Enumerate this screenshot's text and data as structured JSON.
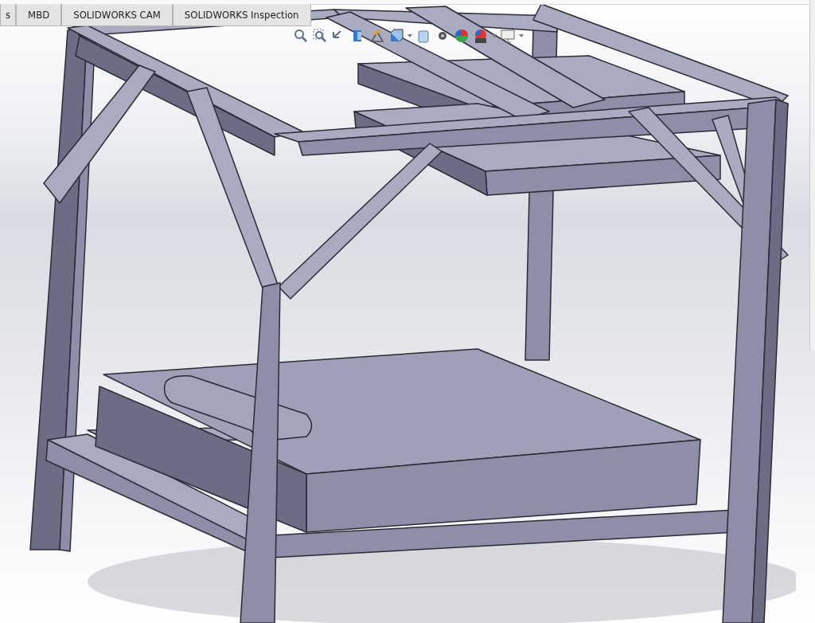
{
  "tabs": [
    {
      "label": "s"
    },
    {
      "label": "MBD"
    },
    {
      "label": "SOLIDWORKS CAM"
    },
    {
      "label": "SOLIDWORKS Inspection"
    }
  ]
}
